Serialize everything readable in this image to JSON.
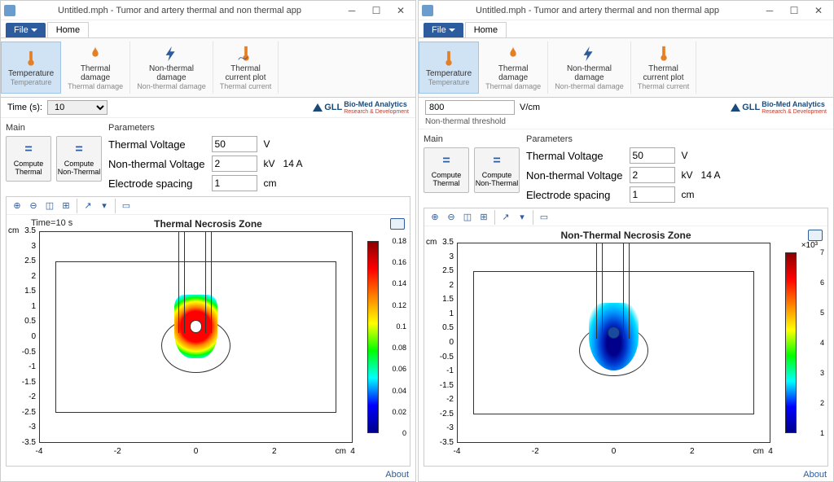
{
  "title": "Untitled.mph - Tumor and artery thermal and non thermal app",
  "file_tab": "File",
  "home_tab": "Home",
  "ribbon": {
    "temperature": "Temperature",
    "temperature_sub": "Temperature",
    "thermal_dmg": "Thermal\ndamage",
    "thermal_dmg_sub": "Thermal damage",
    "nonthermal_dmg": "Non-thermal\ndamage",
    "nonthermal_dmg_sub": "Non-thermal damage",
    "thermal_plot": "Thermal\ncurrent plot",
    "thermal_plot_sub": "Thermal current"
  },
  "left": {
    "time_label": "Time (s):",
    "time_value": "10",
    "plottitle": "Thermal Necrosis Zone",
    "timelbl": "Time=10 s",
    "cticks": [
      "0.18",
      "0.16",
      "0.14",
      "0.12",
      "0.1",
      "0.08",
      "0.06",
      "0.04",
      "0.02",
      "0"
    ]
  },
  "right": {
    "threshold_value": "800",
    "threshold_unit": "V/cm",
    "threshold_label": "Non-thermal threshold",
    "plottitle": "Non-Thermal Necrosis Zone",
    "csup": "×10³",
    "cticks": [
      "7",
      "6",
      "5",
      "4",
      "3",
      "2",
      "1"
    ]
  },
  "main_label": "Main",
  "params_label": "Parameters",
  "compute_thermal": "Compute\nThermal",
  "compute_nonthermal": "Compute\nNon-Thermal",
  "params": {
    "tv_label": "Thermal Voltage",
    "tv_val": "50",
    "tv_unit": "V",
    "ntv_label": "Non-thermal Voltage",
    "ntv_val": "2",
    "ntv_unit": "kV",
    "ntv_extra": "14 A",
    "es_label": "Electrode spacing",
    "es_val": "1",
    "es_unit": "cm"
  },
  "logo": {
    "main": "GLL",
    "sub1": "Bio-Med Analytics",
    "sub2": "Research & Development"
  },
  "axis": {
    "ylabel": "cm",
    "xlabel": "cm",
    "yticks": [
      "3.5",
      "3",
      "2.5",
      "2",
      "1.5",
      "1",
      "0.5",
      "0",
      "-0.5",
      "-1",
      "-1.5",
      "-2",
      "-2.5",
      "-3",
      "-3.5"
    ],
    "xticks": [
      "-4",
      "-2",
      "0",
      "2",
      "4"
    ]
  },
  "about": "About",
  "chart_data": [
    {
      "type": "heatmap",
      "title": "Thermal Necrosis Zone",
      "xlabel": "cm",
      "ylabel": "cm",
      "xlim": [
        -5,
        5
      ],
      "ylim": [
        -3.5,
        3.5
      ],
      "colorbar_range": [
        0,
        0.18
      ],
      "annotation": "Time=10 s"
    },
    {
      "type": "heatmap",
      "title": "Non-Thermal Necrosis Zone",
      "xlabel": "cm",
      "ylabel": "cm",
      "xlim": [
        -5,
        5
      ],
      "ylim": [
        -3.5,
        3.5
      ],
      "colorbar_range": [
        0,
        7000
      ]
    }
  ]
}
